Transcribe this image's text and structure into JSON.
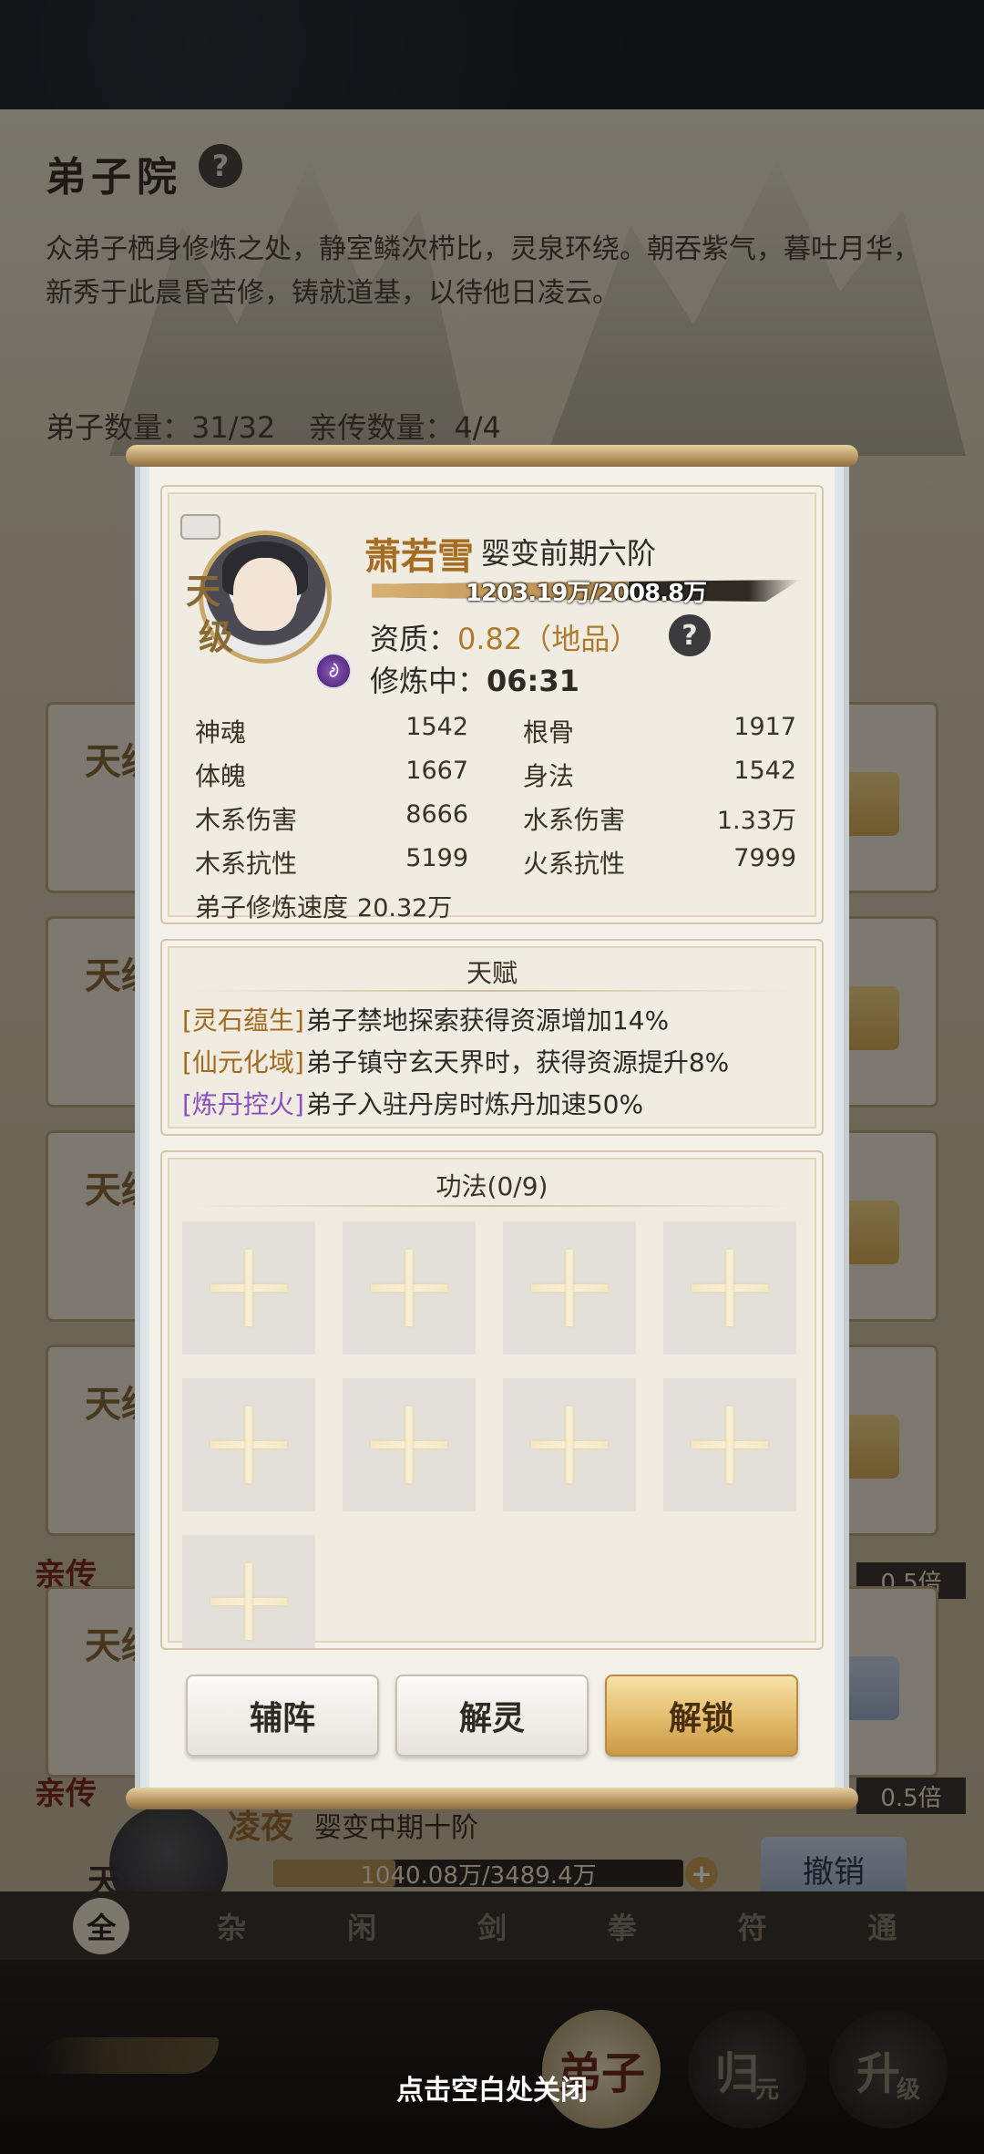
{
  "background": {
    "title": "弟子院",
    "help_icon": "?",
    "description": "众弟子栖身修炼之处，静室鳞次栉比，灵泉环绕。朝吞紫气，暮吐月华，新秀于此晨昏苦修，铸就道基，以待他日凌云。",
    "disciple_count": "弟子数量：31/32",
    "direct_count": "亲传数量：4/4",
    "card_badge": "天级",
    "side_label": "亲传",
    "ratio_1": "0.5倍",
    "ratio_2": "0.5倍",
    "bottom_card": {
      "name": "凌夜",
      "realm": "婴变中期十阶",
      "progress": "1040.08万/3489.4万",
      "progress_fraction": 0.298,
      "plus": "+",
      "revoke_button": "撤销",
      "badge": "天"
    },
    "filter_tabs": [
      "全",
      "杂",
      "闲",
      "剑",
      "拳",
      "符",
      "通"
    ],
    "nav": {
      "disciple": "弟子",
      "return_big": "归",
      "return_small": "元",
      "upgrade_big": "升",
      "upgrade_small": "级"
    }
  },
  "disciple": {
    "grade": [
      "天",
      "级"
    ],
    "element_icon": "wood-spirit-icon",
    "name": "萧若雪",
    "realm": "婴变前期六阶",
    "xp_text": "1203.19万/2008.8万",
    "xp_fraction": 0.599,
    "aptitude_label": "资质：",
    "aptitude_value": "0.82（地品）",
    "help_icon": "?",
    "training_label": "修炼中：",
    "training_value": "06:31",
    "stats": [
      {
        "label": "神魂",
        "value": "1542"
      },
      {
        "label": "根骨",
        "value": "1917"
      },
      {
        "label": "体魄",
        "value": "1667"
      },
      {
        "label": "身法",
        "value": "1542"
      },
      {
        "label": "木系伤害",
        "value": "8666"
      },
      {
        "label": "水系伤害",
        "value": "1.33万"
      },
      {
        "label": "木系抗性",
        "value": "5199"
      },
      {
        "label": "火系抗性",
        "value": "7999"
      },
      {
        "label": "弟子修炼速度",
        "value": "20.32万"
      }
    ]
  },
  "talent": {
    "title": "天赋",
    "items": [
      {
        "tag": "[灵石蕴生]",
        "text": "弟子禁地探索获得资源增加14%"
      },
      {
        "tag": "[仙元化域]",
        "text": "弟子镇守玄天界时，获得资源提升8%"
      },
      {
        "tag": "[炼丹控火]",
        "text": "弟子入驻丹房时炼丹加速50%"
      }
    ]
  },
  "skills": {
    "title": "功法(0/9)"
  },
  "buttons": {
    "formation": "辅阵",
    "release": "解灵",
    "unlock": "解锁"
  },
  "close_hint": "点击空白处关闭",
  "colors": {
    "gold_name": "#a56d22",
    "tag_gold": "#a26a1f",
    "tag_purple": "#8a4fc0",
    "unlock_button": "#e2bb6a"
  }
}
